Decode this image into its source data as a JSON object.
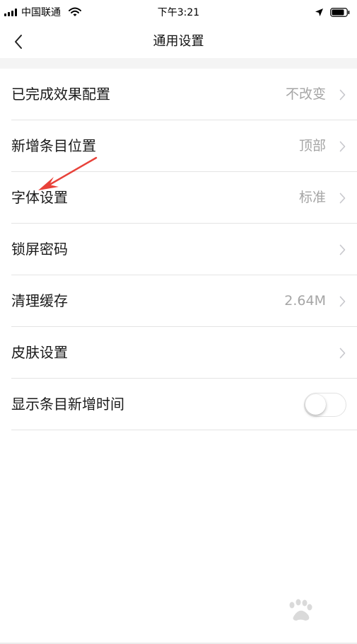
{
  "status_bar": {
    "carrier": "中国联通",
    "time": "下午3:21"
  },
  "nav": {
    "title": "通用设置"
  },
  "settings": [
    {
      "label": "已完成效果配置",
      "value": "不改变"
    },
    {
      "label": "新增条目位置",
      "value": "顶部"
    },
    {
      "label": "字体设置",
      "value": "标准"
    },
    {
      "label": "锁屏密码",
      "value": ""
    },
    {
      "label": "清理缓存",
      "value": "2.64M"
    },
    {
      "label": "皮肤设置",
      "value": ""
    },
    {
      "label": "显示条目新增时间",
      "toggle_on": false
    }
  ],
  "colors": {
    "annotation_arrow": "#e8423a",
    "value_text": "#a5a5a5",
    "divider": "#e4e4e4"
  },
  "icons": [
    "signal-icon",
    "wifi-icon",
    "location-arrow-icon",
    "battery-icon",
    "back-chevron-icon",
    "chevron-right-icon",
    "baidu-paw-icon"
  ]
}
